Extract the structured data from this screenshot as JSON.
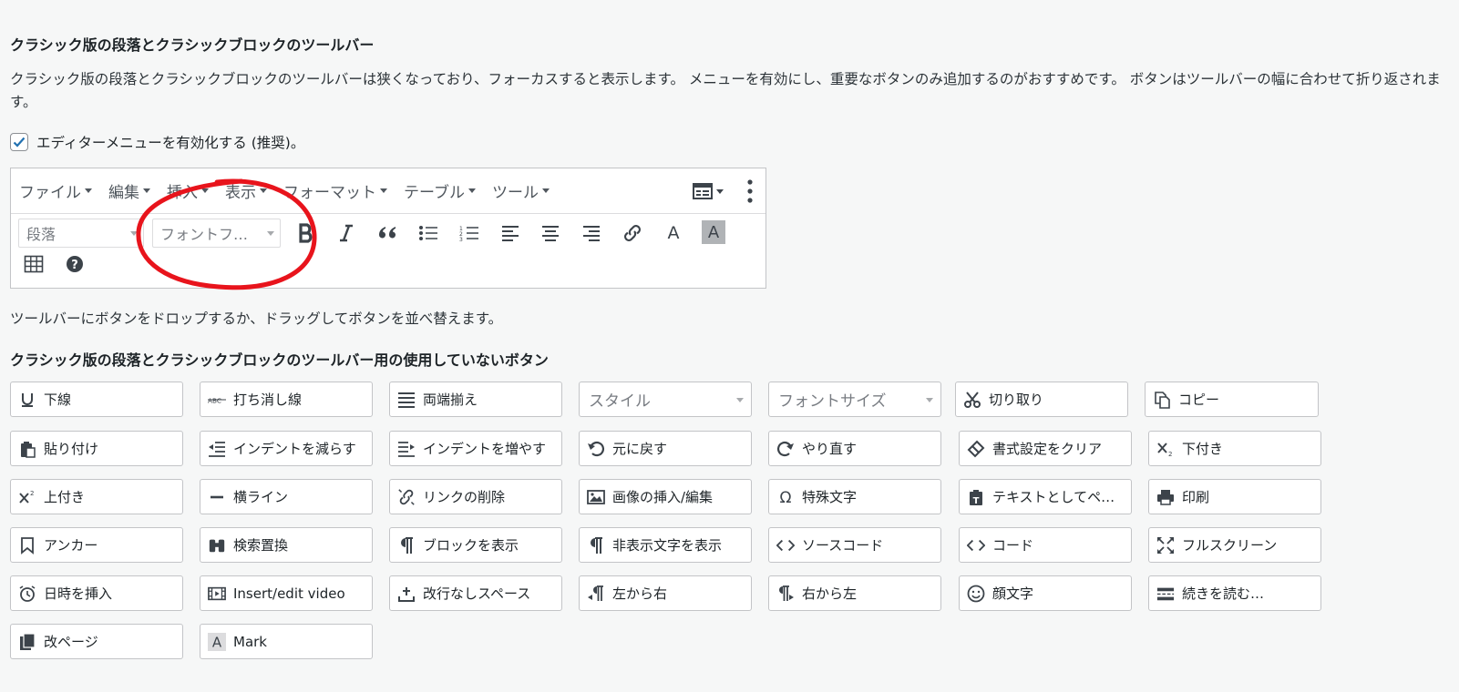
{
  "section_title": "クラシック版の段落とクラシックブロックのツールバー",
  "description": "クラシック版の段落とクラシックブロックのツールバーは狭くなっており、フォーカスすると表示します。 メニューを有効にし、重要なボタンのみ追加するのがおすすめです。 ボタンはツールバーの幅に合わせて折り返されます。",
  "enable_menu": {
    "label": "エディターメニューを有効化する (推奨)。",
    "checked": true
  },
  "menubar": [
    "ファイル",
    "編集",
    "挿入",
    "表示",
    "フォーマット",
    "テーブル",
    "ツール"
  ],
  "toolbar": {
    "format_select": "段落",
    "font_select": "フォントフ…",
    "color_letter": "A",
    "bg_letter": "A"
  },
  "help_text": "ツールバーにボタンをドロップするか、ドラッグしてボタンを並べ替えます。",
  "unused_title": "クラシック版の段落とクラシックブロックのツールバー用の使用していないボタン",
  "unused_rows": [
    [
      {
        "label": "下線",
        "icon": "underline-icon"
      },
      {
        "label": "打ち消し線",
        "icon": "strikethrough-icon"
      },
      {
        "label": "両端揃え",
        "icon": "justify-icon"
      },
      {
        "label": "スタイル",
        "icon": "select"
      },
      {
        "label": "フォントサイズ",
        "icon": "select"
      },
      {
        "label": "切り取り",
        "icon": "scissors-icon"
      },
      {
        "label": "コピー",
        "icon": "copy-icon"
      }
    ],
    [
      {
        "label": "貼り付け",
        "icon": "paste-icon"
      },
      {
        "label": "インデントを減らす",
        "icon": "outdent-icon"
      },
      {
        "label": "インデントを増やす",
        "icon": "indent-icon"
      },
      {
        "label": "元に戻す",
        "icon": "undo-icon"
      },
      {
        "label": "やり直す",
        "icon": "redo-icon"
      },
      {
        "label": "書式設定をクリア",
        "icon": "eraser-icon"
      },
      {
        "label": "下付き",
        "icon": "subscript-icon"
      }
    ],
    [
      {
        "label": "上付き",
        "icon": "superscript-icon"
      },
      {
        "label": "横ライン",
        "icon": "horizontal-line-icon"
      },
      {
        "label": "リンクの削除",
        "icon": "unlink-icon"
      },
      {
        "label": "画像の挿入/編集",
        "icon": "image-icon"
      },
      {
        "label": "特殊文字",
        "icon": "omega-icon"
      },
      {
        "label": "テキストとしてペ…",
        "icon": "paste-text-icon"
      },
      {
        "label": "印刷",
        "icon": "print-icon"
      }
    ],
    [
      {
        "label": "アンカー",
        "icon": "bookmark-icon"
      },
      {
        "label": "検索置換",
        "icon": "binoculars-icon"
      },
      {
        "label": "ブロックを表示",
        "icon": "pilcrow-icon"
      },
      {
        "label": "非表示文字を表示",
        "icon": "pilcrow-icon"
      },
      {
        "label": "ソースコード",
        "icon": "code-icon"
      },
      {
        "label": "コード",
        "icon": "code-icon"
      },
      {
        "label": "フルスクリーン",
        "icon": "fullscreen-icon"
      }
    ],
    [
      {
        "label": "日時を挿入",
        "icon": "clock-icon"
      },
      {
        "label": "Insert/edit video",
        "icon": "video-icon"
      },
      {
        "label": "改行なしスペース",
        "icon": "nbsp-icon"
      },
      {
        "label": "左から右",
        "icon": "ltr-icon"
      },
      {
        "label": "右から左",
        "icon": "rtl-icon"
      },
      {
        "label": "顔文字",
        "icon": "smiley-icon"
      },
      {
        "label": "続きを読む…",
        "icon": "readmore-icon"
      }
    ],
    [
      {
        "label": "改ページ",
        "icon": "pagebreak-icon"
      },
      {
        "label": "Mark",
        "icon": "mark-icon"
      }
    ]
  ],
  "colors": {
    "annotation": "#e8141c",
    "accent": "#2271b1"
  }
}
